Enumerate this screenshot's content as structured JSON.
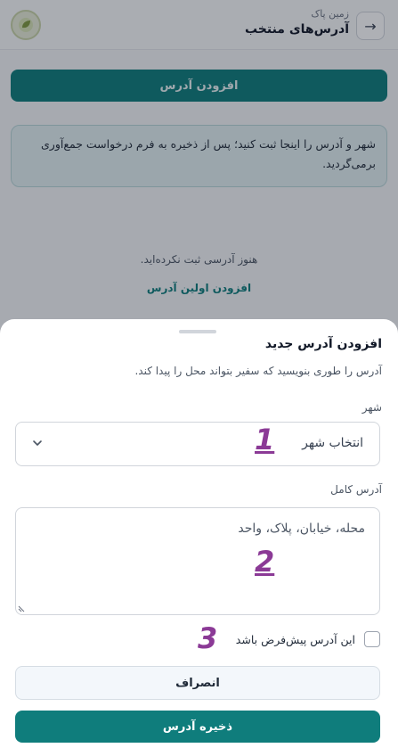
{
  "header": {
    "subtitle": "زمین پاک",
    "title": "آدرس‌های منتخب",
    "back_icon": "arrow-right-icon",
    "logo": "app-logo"
  },
  "main": {
    "add_button_label": "افزودن آدرس",
    "info_text": "شهر و آدرس را اینجا ثبت کنید؛ پس از ذخیره به فرم درخواست جمع‌آوری برمی‌گردید.",
    "empty_text": "هنوز آدرسی ثبت نکرده‌اید.",
    "empty_link": "افزودن اولین آدرس"
  },
  "sheet": {
    "title": "افزودن آدرس جدید",
    "subtitle": "آدرس را طوری بنویسید که سفیر بتواند محل را پیدا کند.",
    "city_label": "شهر",
    "city_value": "انتخاب شهر",
    "address_label": "آدرس کامل",
    "address_placeholder": "محله، خیابان، پلاک، واحد",
    "default_checkbox_label": "این آدرس پیش‌فرض باشد",
    "cancel_label": "انصراف",
    "save_label": "ذخیره آدرس"
  },
  "annotations": {
    "one": "1",
    "two": "2",
    "three": "3"
  },
  "colors": {
    "primary": "#0f7d7c",
    "annotation": "#8b3a96"
  }
}
